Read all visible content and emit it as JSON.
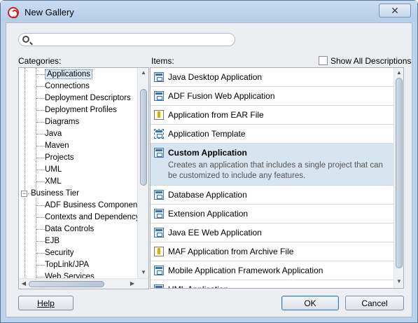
{
  "window": {
    "title": "New Gallery",
    "close_glyph": "✕"
  },
  "search": {
    "placeholder": "",
    "value": ""
  },
  "categories": {
    "label": "Categories:",
    "rows": [
      {
        "label": "Applications",
        "level": 2,
        "selected": true
      },
      {
        "label": "Connections",
        "level": 2
      },
      {
        "label": "Deployment Descriptors",
        "level": 2
      },
      {
        "label": "Deployment Profiles",
        "level": 2
      },
      {
        "label": "Diagrams",
        "level": 2
      },
      {
        "label": "Java",
        "level": 2
      },
      {
        "label": "Maven",
        "level": 2
      },
      {
        "label": "Projects",
        "level": 2
      },
      {
        "label": "UML",
        "level": 2
      },
      {
        "label": "XML",
        "level": 2
      },
      {
        "label": "Business Tier",
        "level": 1,
        "expanded": true
      },
      {
        "label": "ADF Business Components",
        "level": 2
      },
      {
        "label": "Contexts and Dependency",
        "level": 2
      },
      {
        "label": "Data Controls",
        "level": 2
      },
      {
        "label": "EJB",
        "level": 2
      },
      {
        "label": "Security",
        "level": 2
      },
      {
        "label": "TopLink/JPA",
        "level": 2
      },
      {
        "label": "Web Services",
        "level": 2
      }
    ]
  },
  "items": {
    "label": "Items:",
    "show_all_label": "Show All Descriptions",
    "show_all_checked": false,
    "rows": [
      {
        "label": "Java Desktop Application",
        "icon": "application-icon"
      },
      {
        "label": "ADF Fusion Web Application",
        "icon": "application-icon"
      },
      {
        "label": "Application from EAR File",
        "icon": "archive-icon"
      },
      {
        "label": "Application Template",
        "icon": "template-icon"
      },
      {
        "label": "Custom Application",
        "icon": "application-icon",
        "selected": true,
        "description": "Creates an application that includes a single project that can be customized to include any features."
      },
      {
        "label": "Database Application",
        "icon": "application-icon"
      },
      {
        "label": "Extension Application",
        "icon": "application-icon"
      },
      {
        "label": "Java EE Web Application",
        "icon": "application-icon"
      },
      {
        "label": "MAF Application from Archive File",
        "icon": "archive-icon"
      },
      {
        "label": "Mobile Application Framework Application",
        "icon": "application-icon"
      },
      {
        "label": "UML Application",
        "icon": "application-icon"
      }
    ]
  },
  "buttons": {
    "help": "Help",
    "ok": "OK",
    "cancel": "Cancel"
  }
}
